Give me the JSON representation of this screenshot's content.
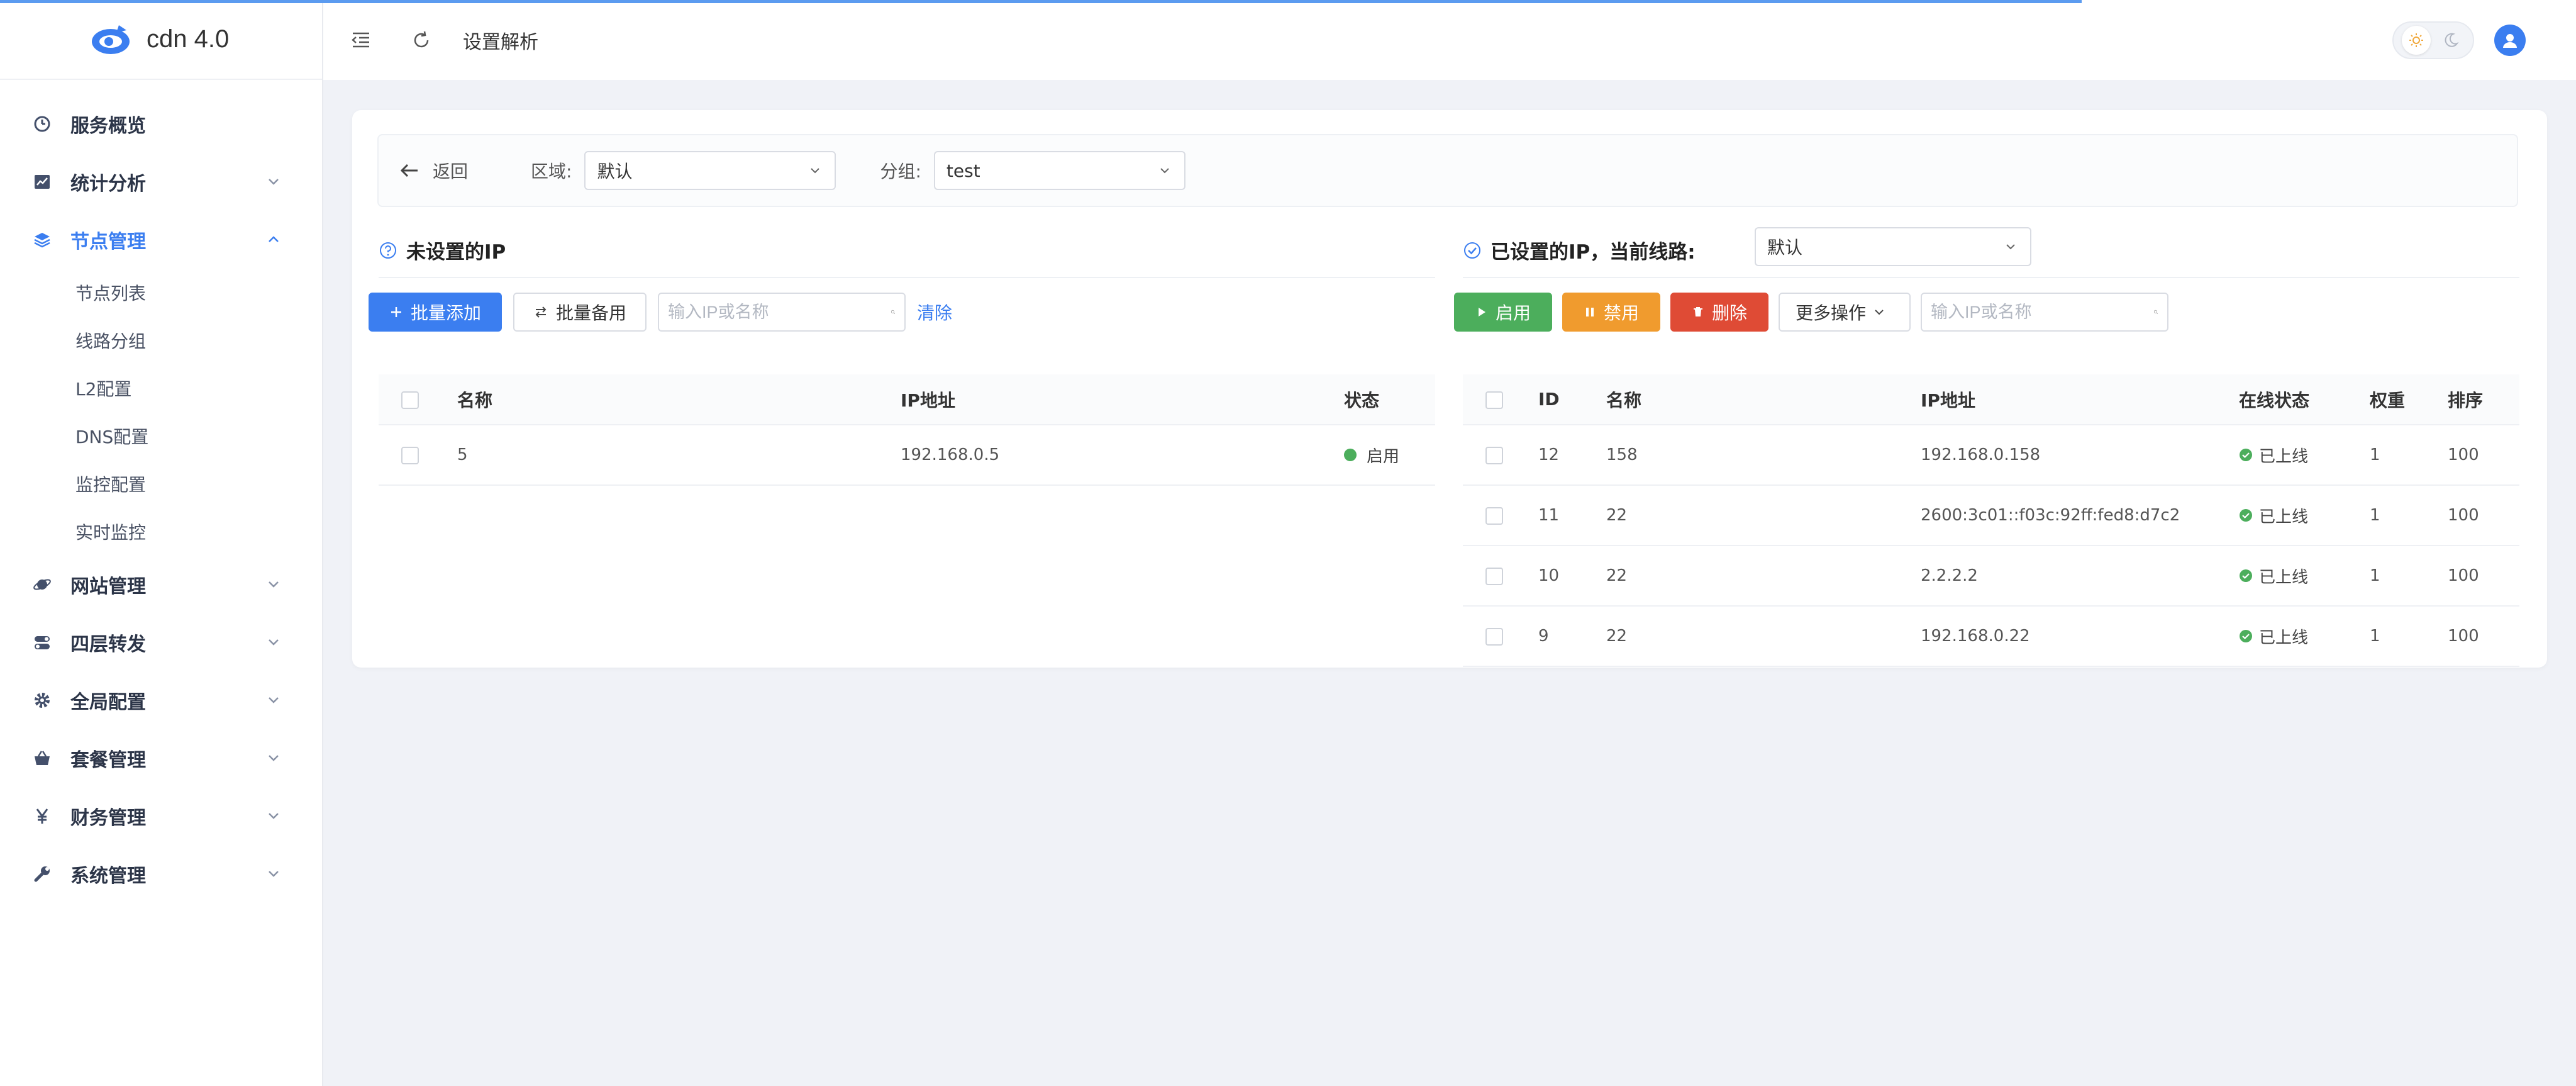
{
  "app": {
    "name": "cdn 4.0"
  },
  "header": {
    "page_title": "设置解析"
  },
  "colors": {
    "primary": "#3b7ef0",
    "success": "#4cae5c",
    "warning": "#f09b2e",
    "danger": "#df4b35"
  },
  "sidebar": {
    "items": [
      {
        "label": "服务概览",
        "icon": "dashboard-icon"
      },
      {
        "label": "统计分析",
        "icon": "chart-icon"
      },
      {
        "label": "节点管理",
        "icon": "layers-icon",
        "expanded": true,
        "children": [
          "节点列表",
          "线路分组",
          "L2配置",
          "DNS配置",
          "监控配置",
          "实时监控"
        ]
      },
      {
        "label": "网站管理",
        "icon": "planet-icon"
      },
      {
        "label": "四层转发",
        "icon": "toggle-icon"
      },
      {
        "label": "全局配置",
        "icon": "gear-icon"
      },
      {
        "label": "套餐管理",
        "icon": "basket-icon"
      },
      {
        "label": "财务管理",
        "icon": "yen-icon"
      },
      {
        "label": "系统管理",
        "icon": "wrench-icon"
      }
    ]
  },
  "filter": {
    "back_label": "返回",
    "area_label": "区域:",
    "area_value": "默认",
    "group_label": "分组:",
    "group_value": "test"
  },
  "left_pane": {
    "title": "未设置的IP",
    "batch_add": "批量添加",
    "batch_backup": "批量备用",
    "search_placeholder": "输入IP或名称",
    "clear": "清除",
    "columns": [
      "名称",
      "IP地址",
      "状态"
    ],
    "rows": [
      {
        "name": "5",
        "ip": "192.168.0.5",
        "status": "启用"
      }
    ]
  },
  "right_pane": {
    "title": "已设置的IP，当前线路:",
    "line_value": "默认",
    "enable": "启用",
    "disable": "禁用",
    "delete": "删除",
    "more": "更多操作",
    "search_placeholder": "输入IP或名称",
    "columns": [
      "ID",
      "名称",
      "IP地址",
      "在线状态",
      "权重",
      "排序"
    ],
    "rows": [
      {
        "id": "12",
        "name": "158",
        "ip": "192.168.0.158",
        "status": "已上线",
        "weight": "1",
        "order": "100"
      },
      {
        "id": "11",
        "name": "22",
        "ip": "2600:3c01::f03c:92ff:fed8:d7c2",
        "status": "已上线",
        "weight": "1",
        "order": "100"
      },
      {
        "id": "10",
        "name": "22",
        "ip": "2.2.2.2",
        "status": "已上线",
        "weight": "1",
        "order": "100"
      },
      {
        "id": "9",
        "name": "22",
        "ip": "192.168.0.22",
        "status": "已上线",
        "weight": "1",
        "order": "100"
      }
    ]
  }
}
